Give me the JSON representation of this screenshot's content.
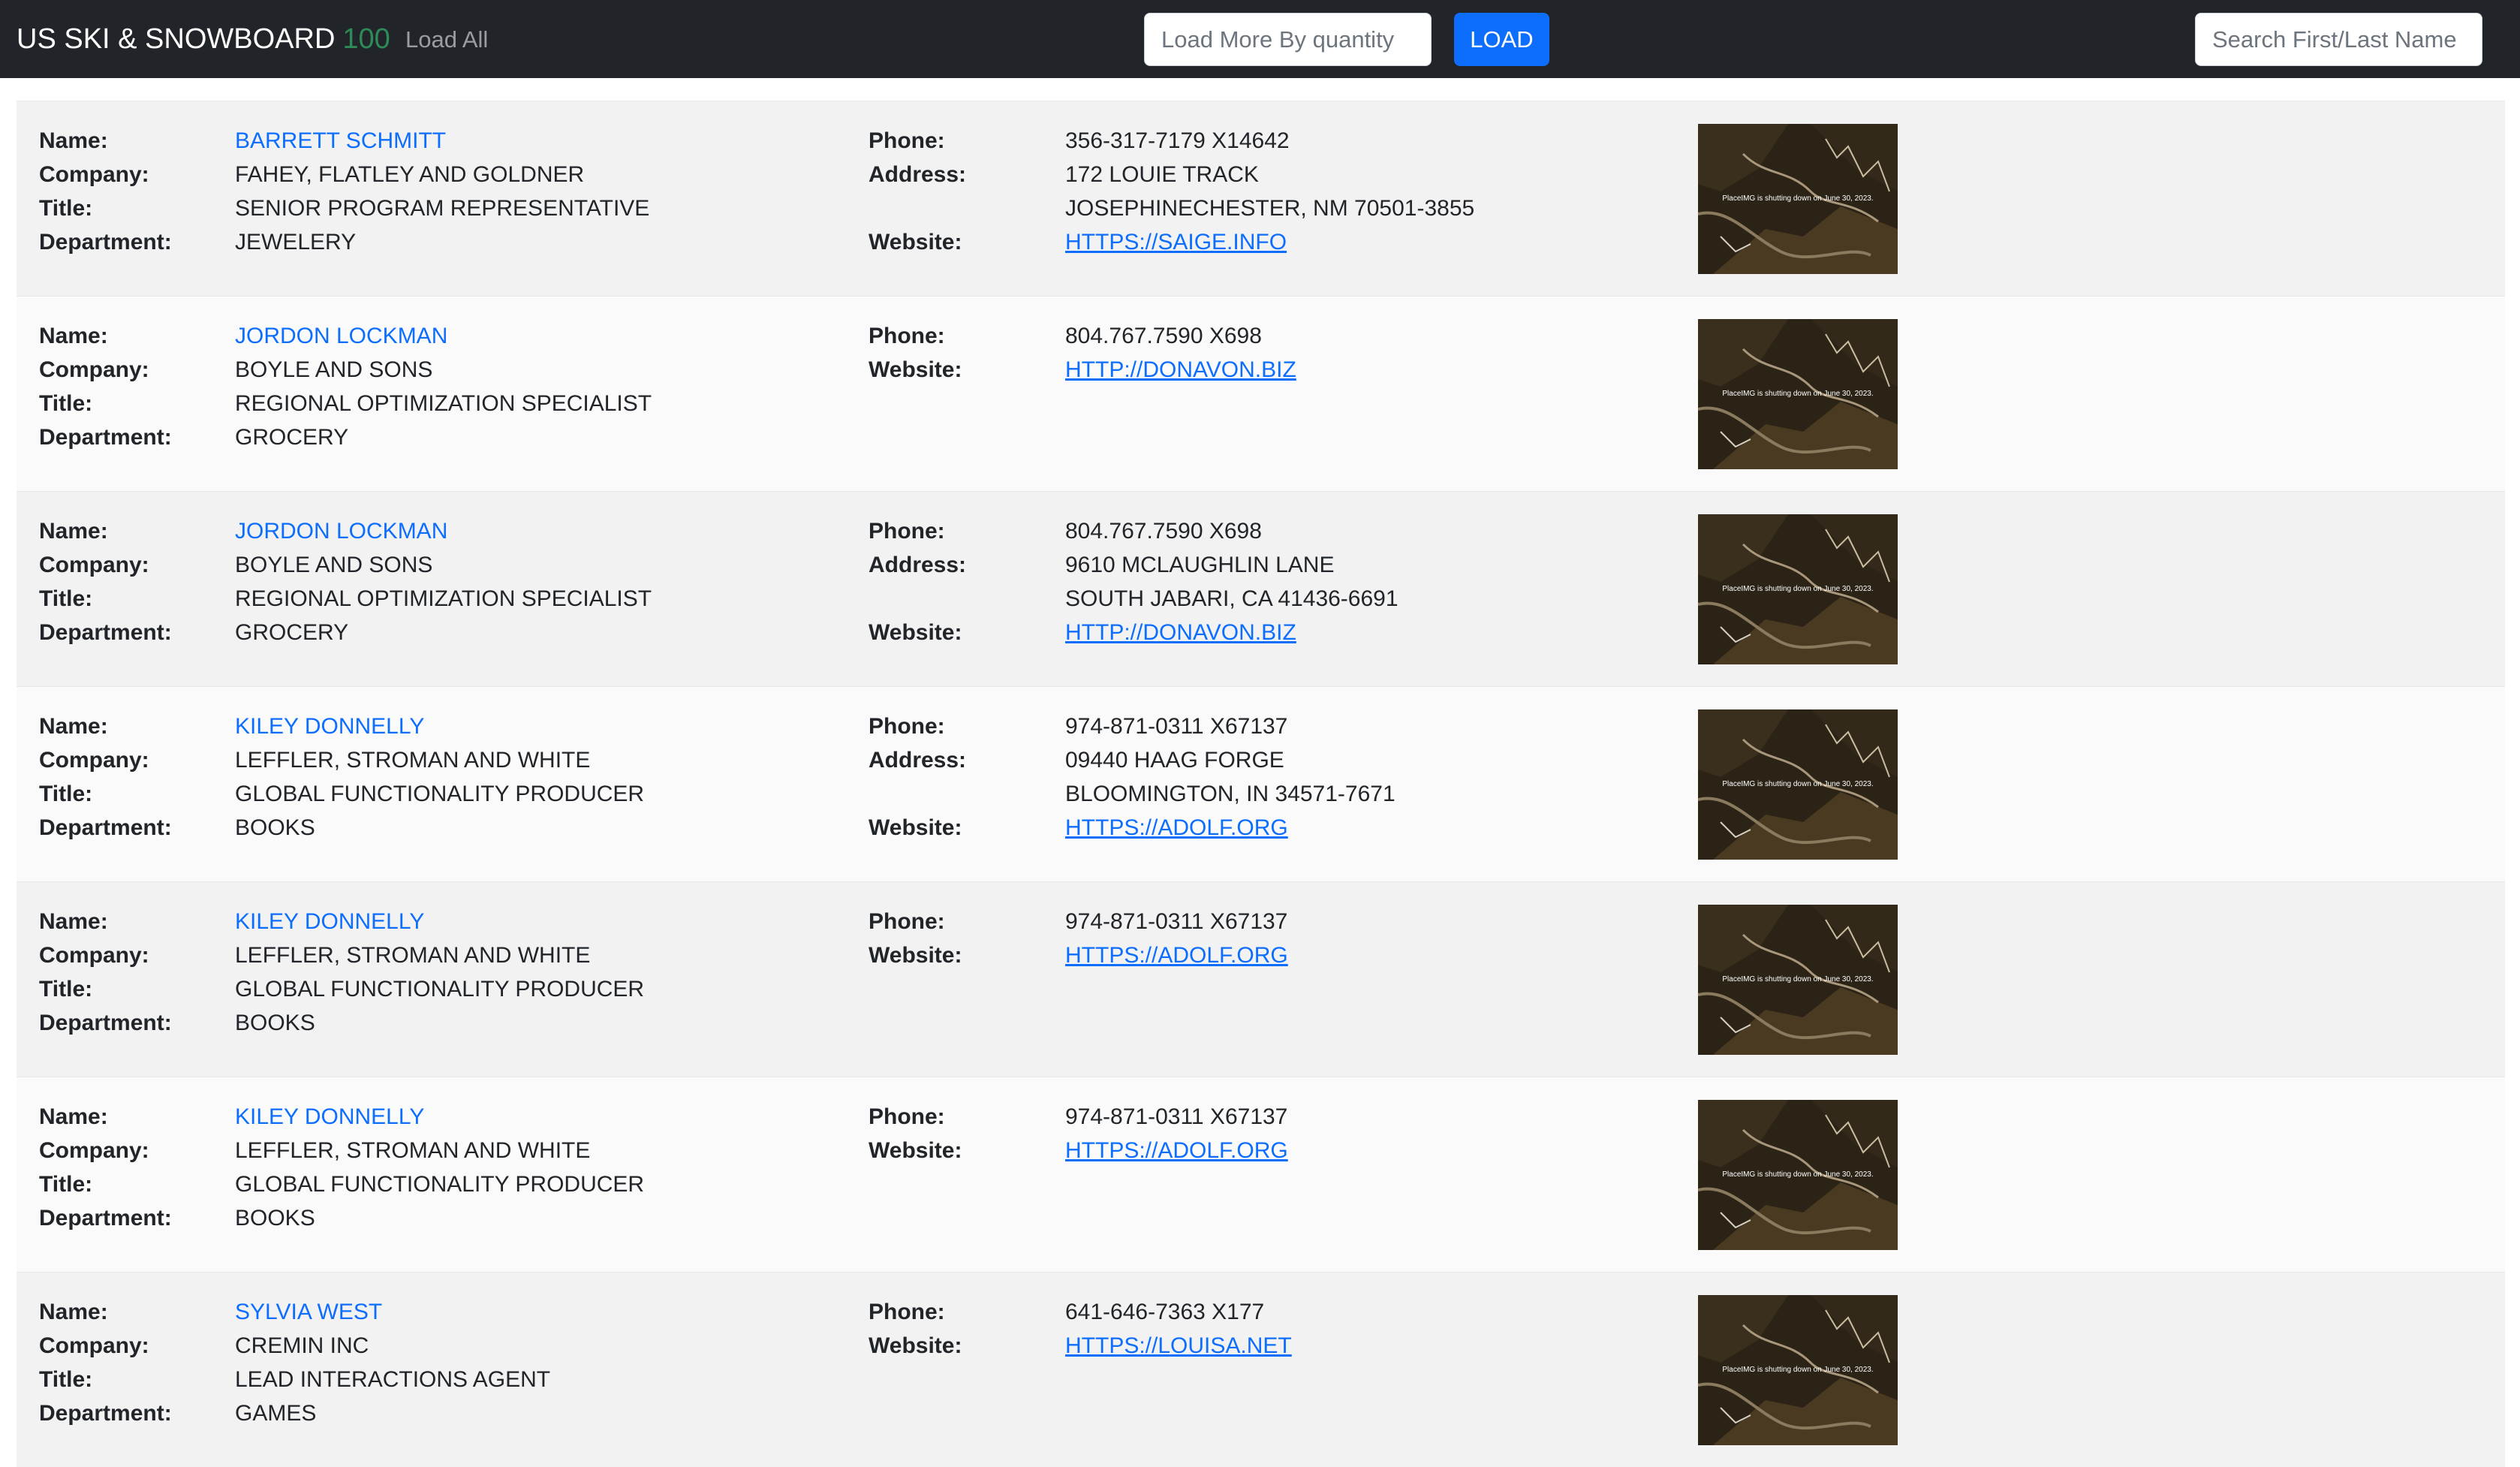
{
  "navbar": {
    "brand": "US SKI & SNOWBOARD",
    "brand_count": "100",
    "load_all": "Load All",
    "quantity_placeholder": "Load More By quantity",
    "load_button": "LOAD",
    "search_placeholder": "Search First/Last Name"
  },
  "labels": {
    "name": "Name:",
    "company": "Company:",
    "title": "Title:",
    "department": "Department:",
    "phone": "Phone:",
    "address": "Address:",
    "website": "Website:"
  },
  "image_caption": "PlaceIMG is shutting down on June 30, 2023.",
  "colors": {
    "navbar_bg": "#212529",
    "brand_count": "#2e8b57",
    "link": "#0d6efd",
    "row_odd": "#f2f2f2",
    "row_even": "#fafafa"
  },
  "records": [
    {
      "name": "BARRETT SCHMITT",
      "company": "FAHEY, FLATLEY AND GOLDNER",
      "title": "SENIOR PROGRAM REPRESENTATIVE",
      "department": "JEWELERY",
      "phone": "356-317-7179 X14642",
      "address_line1": "172 LOUIE TRACK",
      "address_line2": "JOSEPHINECHESTER, NM 70501-3855",
      "website": "HTTPS://SAIGE.INFO"
    },
    {
      "name": "JORDON LOCKMAN",
      "company": "BOYLE AND SONS",
      "title": "REGIONAL OPTIMIZATION SPECIALIST",
      "department": "GROCERY",
      "phone": "804.767.7590 X698",
      "address_line1": "",
      "address_line2": "",
      "website": "HTTP://DONAVON.BIZ"
    },
    {
      "name": "JORDON LOCKMAN",
      "company": "BOYLE AND SONS",
      "title": "REGIONAL OPTIMIZATION SPECIALIST",
      "department": "GROCERY",
      "phone": "804.767.7590 X698",
      "address_line1": "9610 MCLAUGHLIN LANE",
      "address_line2": "SOUTH JABARI, CA 41436-6691",
      "website": "HTTP://DONAVON.BIZ"
    },
    {
      "name": "KILEY DONNELLY",
      "company": "LEFFLER, STROMAN AND WHITE",
      "title": "GLOBAL FUNCTIONALITY PRODUCER",
      "department": "BOOKS",
      "phone": "974-871-0311 X67137",
      "address_line1": "09440 HAAG FORGE",
      "address_line2": "BLOOMINGTON, IN 34571-7671",
      "website": "HTTPS://ADOLF.ORG"
    },
    {
      "name": "KILEY DONNELLY",
      "company": "LEFFLER, STROMAN AND WHITE",
      "title": "GLOBAL FUNCTIONALITY PRODUCER",
      "department": "BOOKS",
      "phone": "974-871-0311 X67137",
      "address_line1": "",
      "address_line2": "",
      "website": "HTTPS://ADOLF.ORG"
    },
    {
      "name": "KILEY DONNELLY",
      "company": "LEFFLER, STROMAN AND WHITE",
      "title": "GLOBAL FUNCTIONALITY PRODUCER",
      "department": "BOOKS",
      "phone": "974-871-0311 X67137",
      "address_line1": "",
      "address_line2": "",
      "website": "HTTPS://ADOLF.ORG"
    },
    {
      "name": "SYLVIA WEST",
      "company": "CREMIN INC",
      "title": "LEAD INTERACTIONS AGENT",
      "department": "GAMES",
      "phone": "641-646-7363 X177",
      "address_line1": "",
      "address_line2": "",
      "website": "HTTPS://LOUISA.NET"
    }
  ]
}
